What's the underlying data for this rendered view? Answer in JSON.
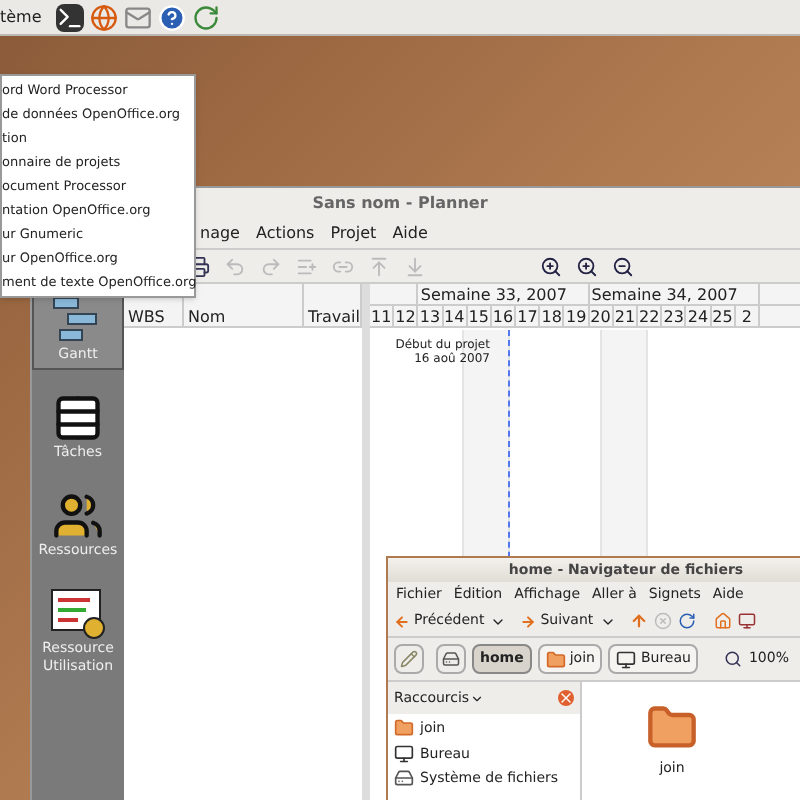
{
  "top_panel": {
    "menu_label": "tème"
  },
  "app_menu": {
    "items": [
      "ord Word Processor",
      "de données OpenOffice.org",
      "tion",
      "onnaire de projets",
      "ocument Processor",
      "ntation OpenOffice.org",
      "ur Gnumeric",
      "ur OpenOffice.org",
      "ment de texte OpenOffice.org"
    ]
  },
  "planner": {
    "title": "Sans nom - Planner",
    "menus": [
      "nage",
      "Actions",
      "Projet",
      "Aide"
    ],
    "views": [
      {
        "label": "Gantt",
        "kind": "gantt",
        "selected": true
      },
      {
        "label": "Tâches",
        "kind": "table",
        "selected": false
      },
      {
        "label": "Ressources",
        "kind": "resources",
        "selected": false
      },
      {
        "label": "Ressource Utilisation",
        "kind": "usage",
        "selected": false
      }
    ],
    "columns": [
      "WBS",
      "Nom",
      "Travail"
    ],
    "weeks": [
      "Semaine 33, 2007",
      "Semaine 34, 2007"
    ],
    "days": [
      "11",
      "12",
      "13",
      "14",
      "15",
      "16",
      "17",
      "18",
      "19",
      "20",
      "21",
      "22",
      "23",
      "24",
      "25",
      "2"
    ],
    "project_start": {
      "label": "Début du projet",
      "date": "16 aoû 2007"
    }
  },
  "file_manager": {
    "title": "home - Navigateur de fichiers",
    "menus": [
      "Fichier",
      "Édition",
      "Affichage",
      "Aller à",
      "Signets",
      "Aide"
    ],
    "back": "Précédent",
    "forward": "Suivant",
    "path": [
      {
        "label": "home",
        "kind": "home",
        "selected": true
      },
      {
        "label": "join",
        "kind": "folder",
        "selected": false
      },
      {
        "label": "Bureau",
        "kind": "desktop",
        "selected": false
      }
    ],
    "zoom": "100%",
    "sidebar_title": "Raccourcis",
    "places": [
      {
        "label": "join",
        "kind": "folder"
      },
      {
        "label": "Bureau",
        "kind": "desktop"
      },
      {
        "label": "Système de fichiers",
        "kind": "drive"
      }
    ],
    "files": [
      {
        "label": "join"
      }
    ]
  }
}
